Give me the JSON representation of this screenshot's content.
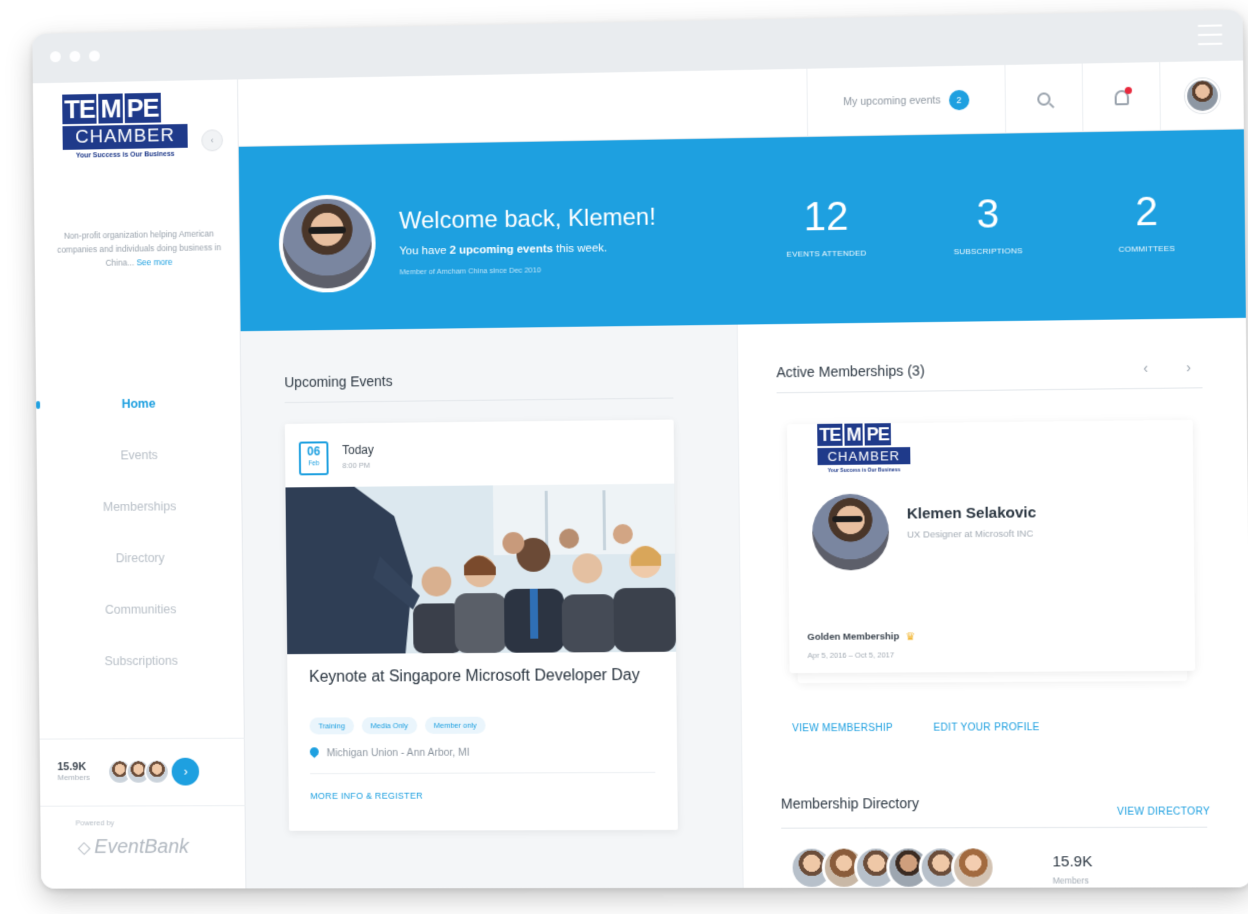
{
  "org": {
    "logo_top": [
      "TE",
      "M",
      "PE"
    ],
    "logo_name": "CHAMBER",
    "logo_tagline": "Your Success is Our Business",
    "description": "Non-profit organization helping American companies and individuals doing business in China...",
    "see_more": "See more"
  },
  "sidebar": {
    "collapse_glyph": "‹",
    "items": [
      {
        "label": "Home",
        "active": true
      },
      {
        "label": "Events",
        "active": false
      },
      {
        "label": "Memberships",
        "active": false
      },
      {
        "label": "Directory",
        "active": false
      },
      {
        "label": "Communities",
        "active": false
      },
      {
        "label": "Subscriptions",
        "active": false
      }
    ],
    "members_count": "15.9K",
    "members_label": "Members",
    "members_go": "›",
    "powered_by": "Powered by",
    "brand": "EventBank",
    "brand_glyph": "◇"
  },
  "topbar": {
    "upcoming_label": "My upcoming events",
    "upcoming_count": "2"
  },
  "banner": {
    "welcome": "Welcome back, Klemen!",
    "sub_prefix": "You have ",
    "sub_bold": "2 upcoming events",
    "sub_suffix": " this week.",
    "meta": "Member of Amcham China since Dec 2010",
    "stats": [
      {
        "value": "12",
        "label": "EVENTS ATTENDED"
      },
      {
        "value": "3",
        "label": "SUBSCRIPTIONS"
      },
      {
        "value": "2",
        "label": "COMMITTEES"
      }
    ]
  },
  "events": {
    "section_title": "Upcoming Events",
    "card": {
      "day": "06",
      "month": "Feb",
      "when": "Today",
      "time": "8:00 PM",
      "title": "Keynote at Singapore Microsoft Developer Day",
      "tags": [
        "Training",
        "Media Only",
        "Member only"
      ],
      "location": "Michigan Union - Ann Arbor, MI",
      "cta": "MORE INFO & REGISTER"
    }
  },
  "memberships": {
    "section_title": "Active Memberships (3)",
    "prev": "‹",
    "next": "›",
    "card": {
      "name": "Klemen Selakovic",
      "role": "UX Designer at Microsoft INC",
      "type": "Golden Membership",
      "crown": "♛",
      "dates": "Apr 5, 2016 – Oct 5, 2017"
    },
    "view_link": "VIEW MEMBERSHIP",
    "edit_link": "EDIT YOUR PROFILE"
  },
  "directory": {
    "section_title": "Membership Directory",
    "view_link": "VIEW DIRECTORY",
    "count": "15.9K",
    "label": "Members"
  },
  "colors": {
    "accent": "#1ea0e0",
    "logo_blue": "#1f3a8a",
    "notification": "#e8283c",
    "crown": "#f2b632"
  }
}
